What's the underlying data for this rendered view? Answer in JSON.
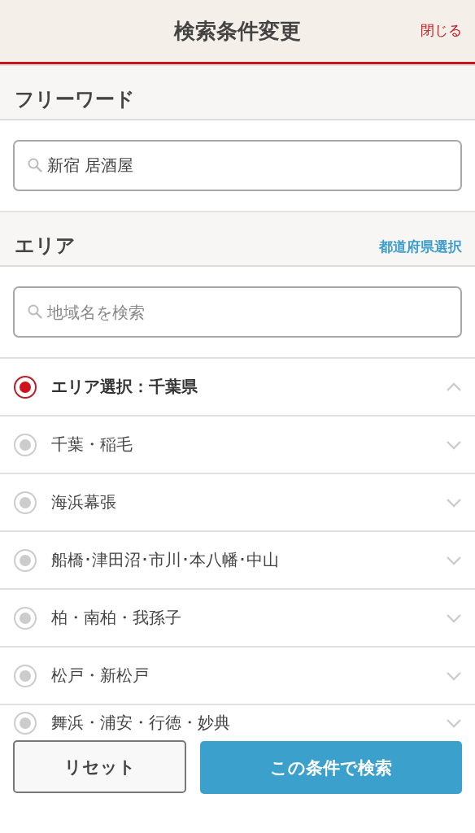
{
  "header": {
    "title": "検索条件変更",
    "close": "閉じる"
  },
  "freeword": {
    "heading": "フリーワード",
    "search": {
      "value": "新宿 居酒屋"
    }
  },
  "area": {
    "heading": "エリア",
    "prefecture_link": "都道府県選択",
    "search": {
      "placeholder": "地域名を検索"
    },
    "items": [
      {
        "label": "エリア選択：千葉県",
        "selected": true,
        "expanded": true
      },
      {
        "label": "千葉・稲毛",
        "selected": false,
        "expanded": false
      },
      {
        "label": "海浜幕張",
        "selected": false,
        "expanded": false
      },
      {
        "label": "船橋･津田沼･市川･本八幡･中山",
        "selected": false,
        "expanded": false
      },
      {
        "label": "柏・南柏・我孫子",
        "selected": false,
        "expanded": false
      },
      {
        "label": "松戸・新松戸",
        "selected": false,
        "expanded": false
      },
      {
        "label": "舞浜・浦安・行徳・妙典",
        "selected": false,
        "expanded": false
      }
    ]
  },
  "buttons": {
    "reset": "リセット",
    "search": "この条件で検索"
  }
}
